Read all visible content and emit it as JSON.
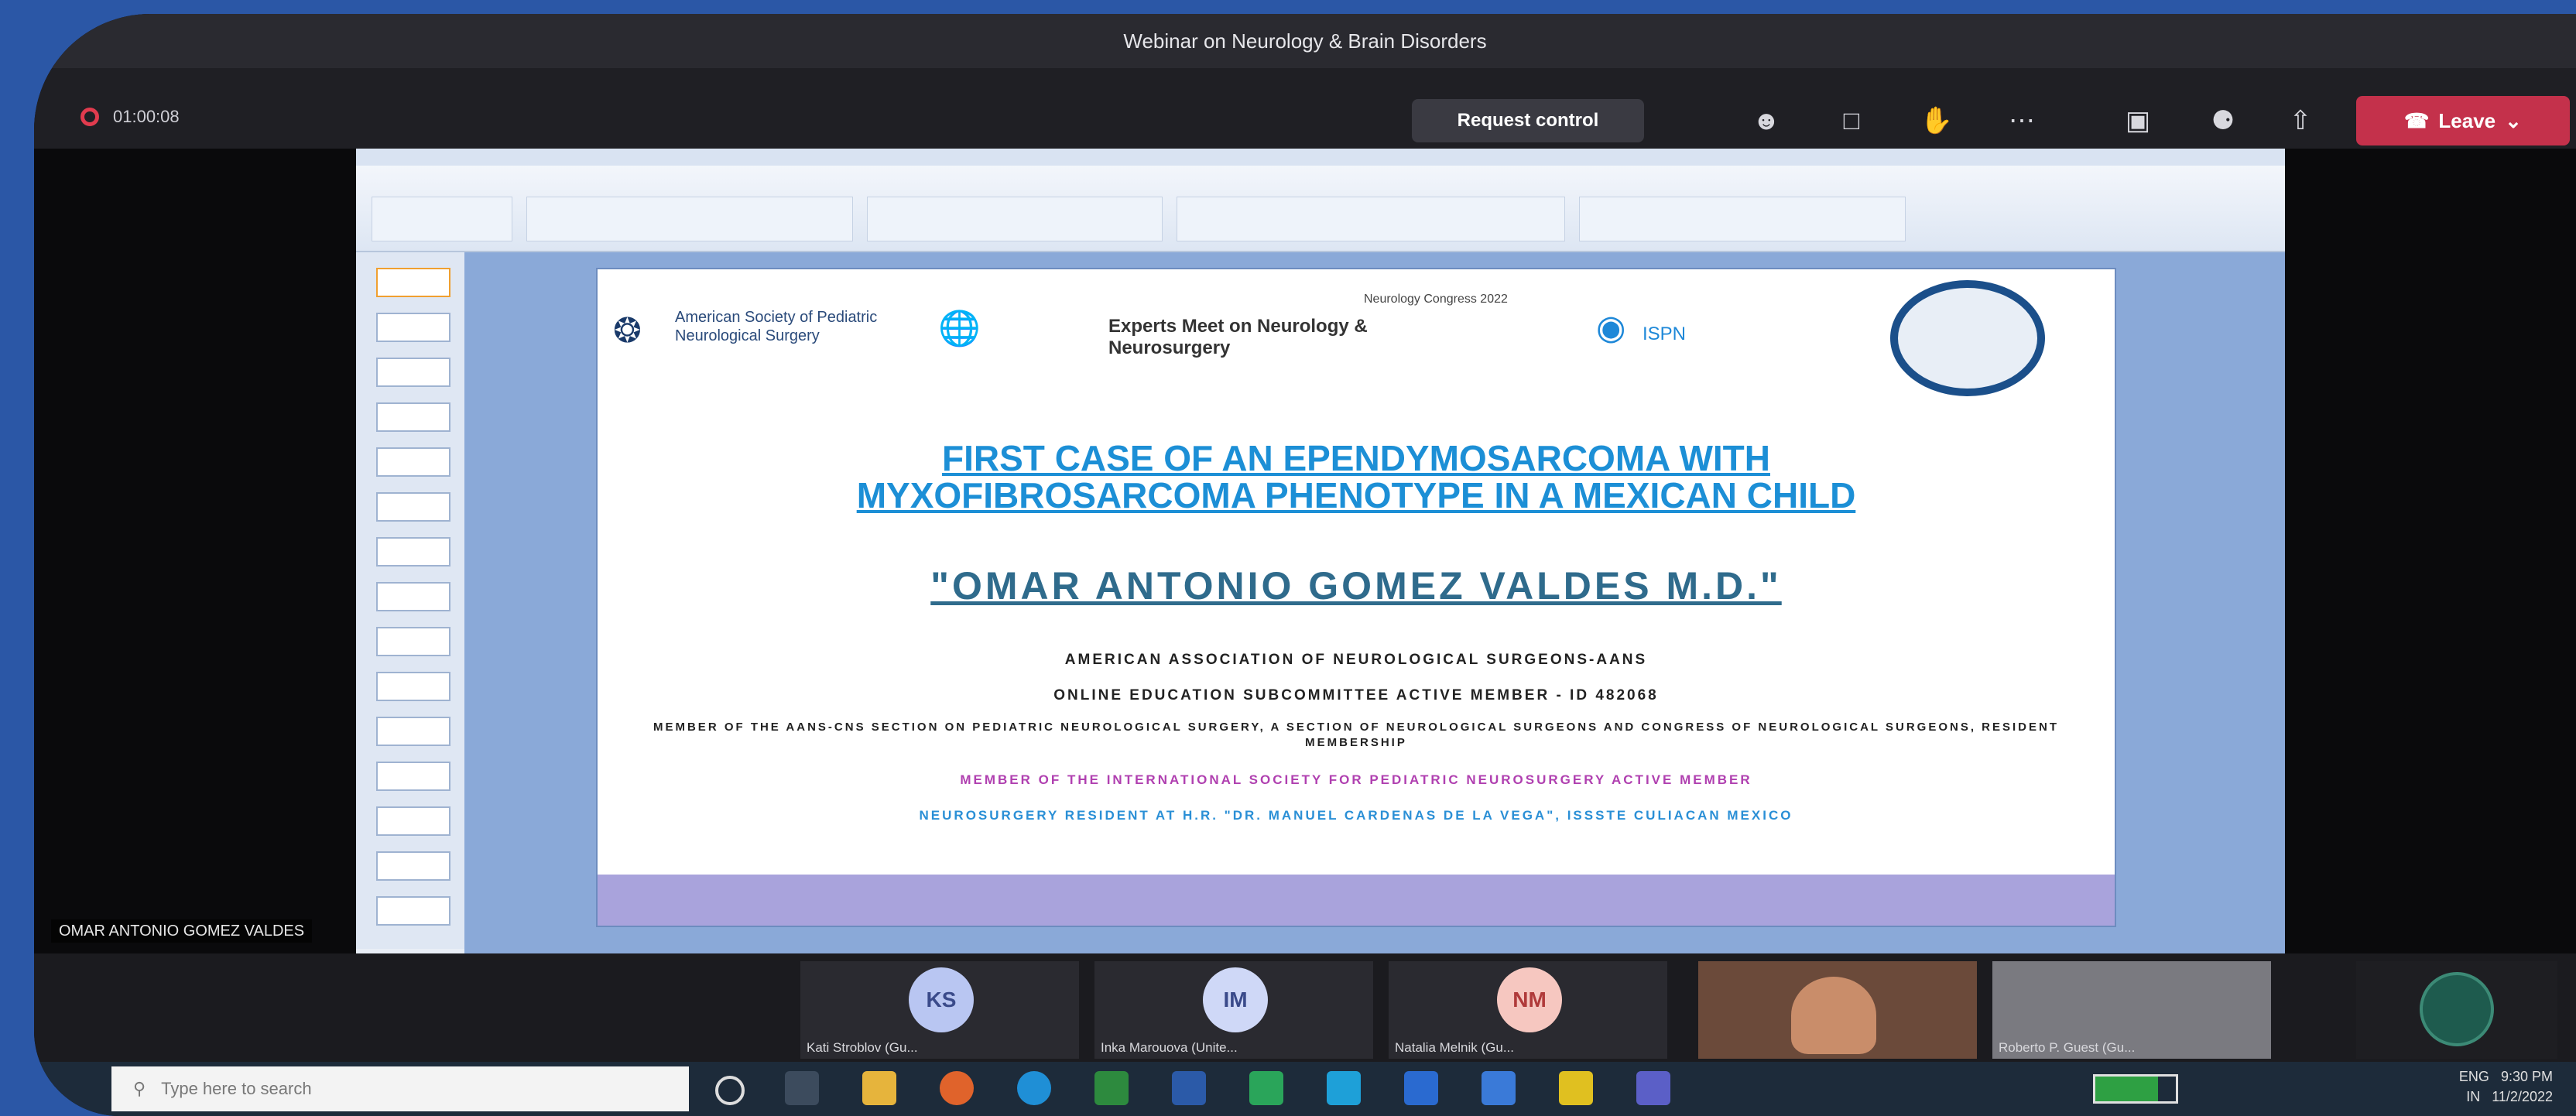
{
  "window": {
    "title": "Webinar on Neurology & Brain Disorders"
  },
  "meeting": {
    "timer": "01:00:08",
    "request_control_label": "Request control",
    "leave_label": "Leave",
    "toolbar_icons": [
      "people-icon",
      "chat-icon",
      "raise-hand-icon",
      "more-icon",
      "camera-off-icon",
      "mic-off-icon",
      "share-icon"
    ]
  },
  "presentation": {
    "window_title": "",
    "slide": {
      "org_logo_text": "American Society of Pediatric Neurological Surgery",
      "event_name": "Experts Meet on Neurology & Neurosurgery",
      "congress": "Neurology Congress 2022",
      "isps_label": "ISPN",
      "title_line1": "FIRST CASE OF AN EPENDYMOSARCOMA WITH",
      "title_line2": "MYXOFIBROSARCOMA PHENOTYPE IN A MEXICAN CHILD",
      "author": "\"OMAR ANTONIO GOMEZ VALDES M.D.\"",
      "line1": "AMERICAN ASSOCIATION OF NEUROLOGICAL SURGEONS-AANS",
      "line2": "ONLINE EDUCATION SUBCOMMITTEE ACTIVE MEMBER - ID 482068",
      "line3": "MEMBER OF THE AANS-CNS SECTION ON PEDIATRIC NEUROLOGICAL SURGERY, A SECTION OF NEUROLOGICAL SURGEONS AND CONGRESS OF NEUROLOGICAL SURGEONS, RESIDENT MEMBERSHIP",
      "line4": "MEMBER OF THE INTERNATIONAL SOCIETY FOR PEDIATRIC NEUROSURGERY ACTIVE MEMBER",
      "line5": "NEUROSURGERY RESIDENT AT H.R. \"DR. MANUEL CARDENAS DE LA VEGA\", ISSSTE CULIACAN MEXICO"
    },
    "presenter_name": "OMAR ANTONIO GOMEZ VALDES"
  },
  "participants": [
    {
      "initials": "KS",
      "name": "Kati Stroblov (Gu...",
      "color": "#b9c6f2"
    },
    {
      "initials": "IM",
      "name": "Inka Marouova (Unite...",
      "color": "#cfd8f7"
    },
    {
      "initials": "NM",
      "name": "Natalia Melnik (Gu...",
      "color": "#f6c7c0"
    },
    {
      "initials": "",
      "name": "",
      "color": "#6b4a3a"
    },
    {
      "initials": "",
      "name": "Roberto P. Guest (Gu...",
      "color": "#7a7a80"
    },
    {
      "initials": "",
      "name": "",
      "color": "#1e5b4e"
    }
  ],
  "taskbar": {
    "search_placeholder": "Type here to search",
    "battery_level": 0.78,
    "lang": "ENG",
    "region": "IN",
    "time": "9:30 PM",
    "date": "11/2/2022"
  },
  "colors": {
    "leave": "#c4314b",
    "slide_title": "#1c8fd6",
    "author": "#2f6b8c",
    "line4": "#b040b0",
    "line5": "#2a8fd6"
  }
}
